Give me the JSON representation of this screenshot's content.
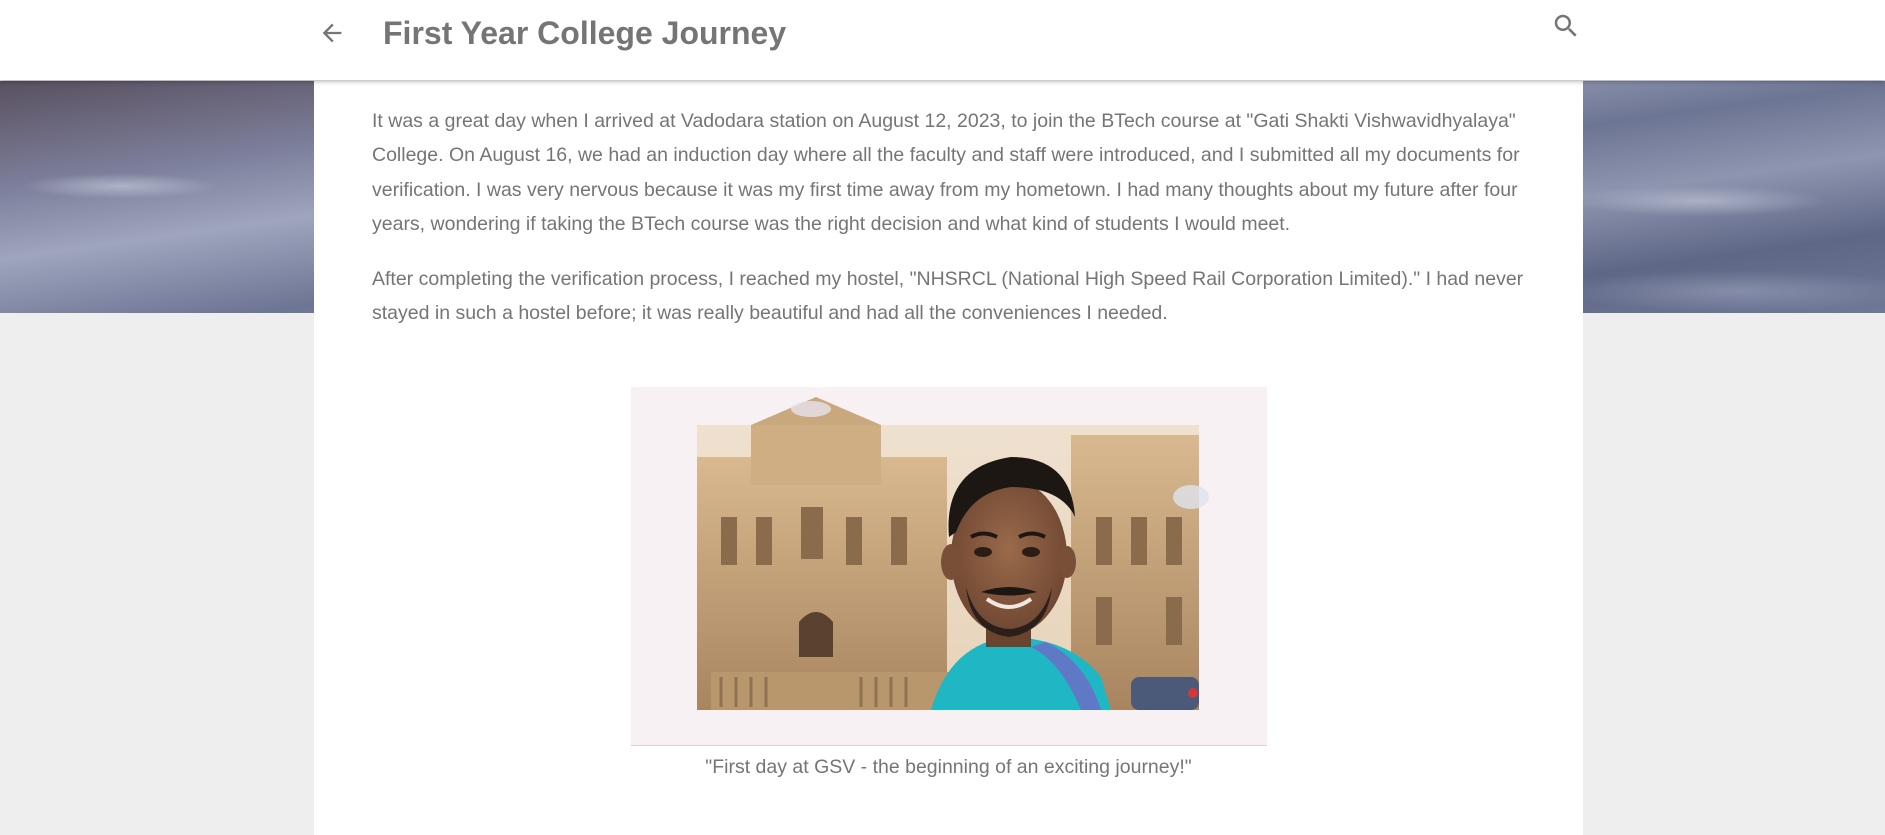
{
  "header": {
    "title": "First Year College Journey",
    "back_icon": "arrow-left-icon",
    "search_icon": "search-icon"
  },
  "post": {
    "paragraphs": [
      "It was a great day when I arrived at Vadodara station on August 12, 2023, to join the BTech course at \"Gati Shakti Vishwavidhyalaya\" College. On August 16, we had an induction day where all the faculty and staff were introduced, and I submitted all my documents for verification. I was very nervous because it was my first time away from my hometown. I had many thoughts about my future after four years, wondering if taking the BTech course was the right decision and what kind of students I would meet.",
      "After completing the verification process, I reached my hostel, \"NHSRCL (National High Speed Rail Corporation Limited).\" I had never stayed in such a hostel before; it was really beautiful and had all the conveniences I needed."
    ],
    "image_caption": "\"First day at GSV - the beginning of an exciting journey!\""
  },
  "colors": {
    "header_bg": "#ffffff",
    "title_text": "#757575",
    "body_text": "#757575",
    "page_bg": "#eeeeee"
  }
}
